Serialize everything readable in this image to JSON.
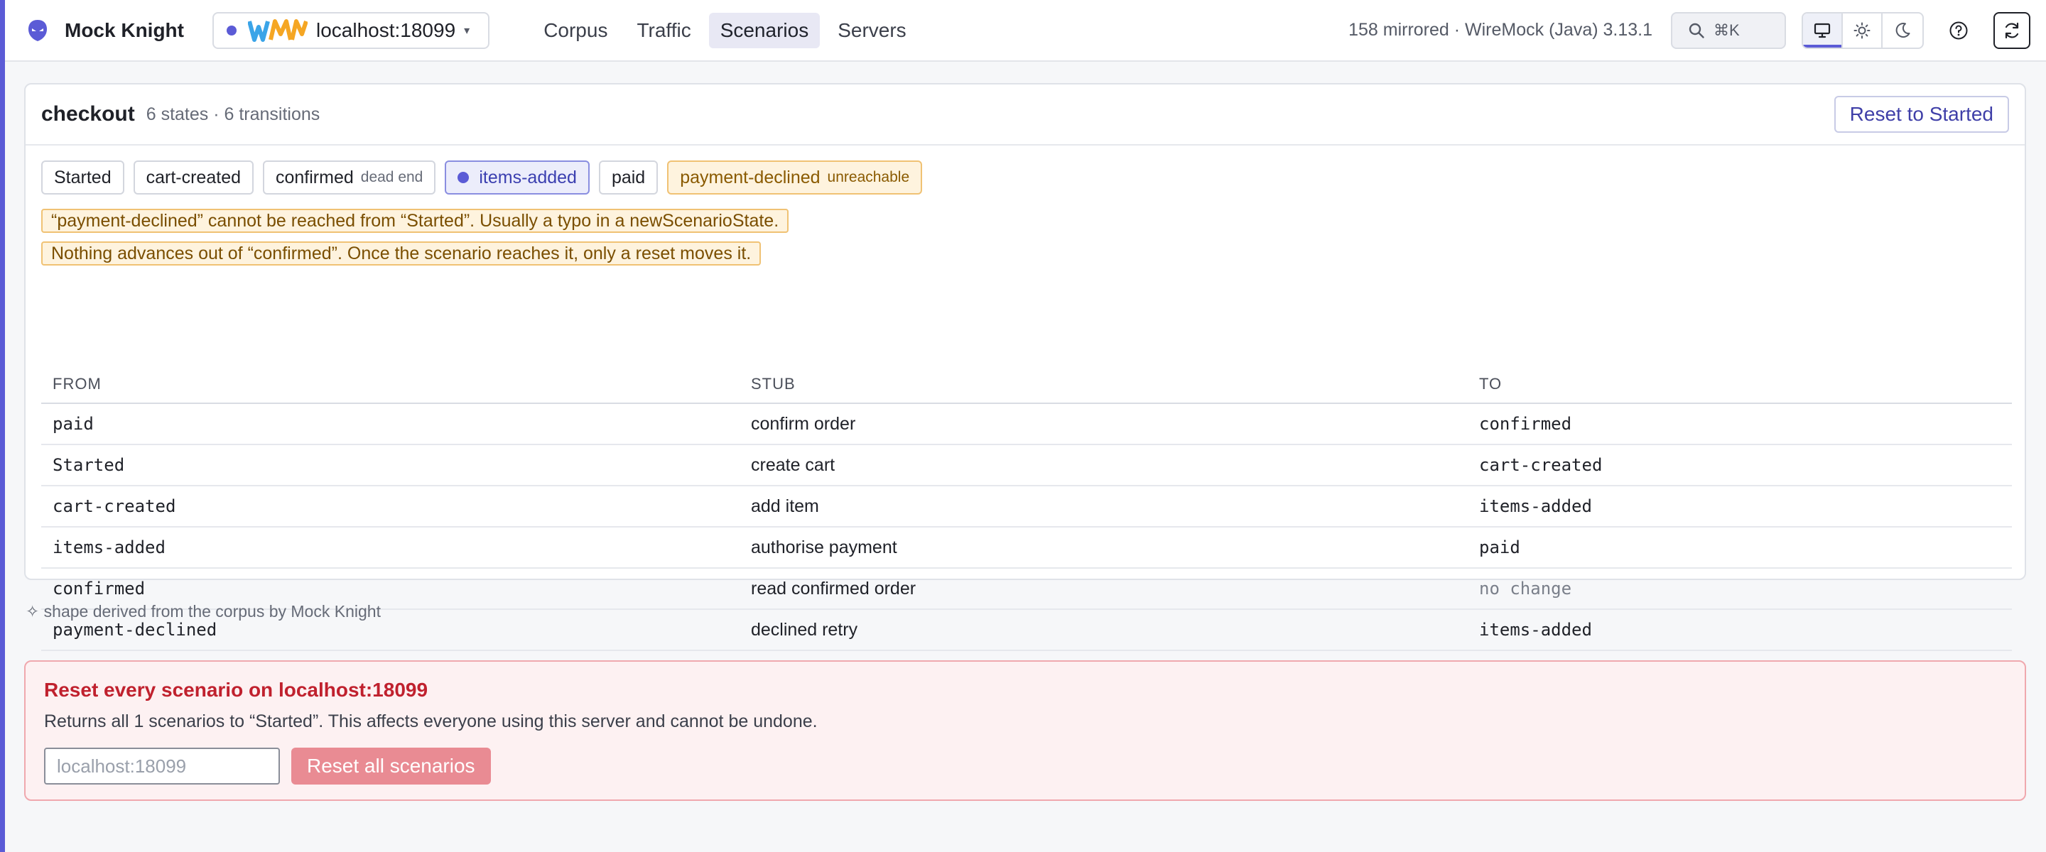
{
  "app": {
    "name": "Mock Knight",
    "brand_icon": "knight-helmet-icon",
    "accent_color": "#5b5bd6"
  },
  "server_picker": {
    "logo_text": "WM",
    "server": "localhost:18099",
    "status_color": "#5b5bd6"
  },
  "nav": {
    "items": [
      {
        "label": "Corpus",
        "active": false
      },
      {
        "label": "Traffic",
        "active": false
      },
      {
        "label": "Scenarios",
        "active": true
      },
      {
        "label": "Servers",
        "active": false
      }
    ]
  },
  "header": {
    "server_meta": "158 mirrored · WireMock (Java) 3.13.1",
    "search_shortcut": "⌘K",
    "theme_options": [
      "monitor-icon",
      "sun-icon",
      "moon-icon"
    ],
    "theme_selected": "monitor-icon"
  },
  "scenario": {
    "name": "checkout",
    "counts": "6 states · 6 transitions",
    "reset_label": "Reset to Started",
    "states": [
      {
        "label": "Started",
        "note": "",
        "kind": "normal"
      },
      {
        "label": "cart-created",
        "note": "",
        "kind": "normal"
      },
      {
        "label": "confirmed",
        "note": "dead end",
        "kind": "normal"
      },
      {
        "label": "items-added",
        "note": "",
        "kind": "current"
      },
      {
        "label": "paid",
        "note": "",
        "kind": "normal"
      },
      {
        "label": "payment-declined",
        "note": "unreachable",
        "kind": "warn"
      }
    ],
    "warnings": [
      "“payment-declined” cannot be reached from “Started”. Usually a typo in a newScenarioState.",
      "Nothing advances out of “confirmed”. Once the scenario reaches it, only a reset moves it."
    ],
    "table": {
      "headers": {
        "from": "FROM",
        "stub": "STUB",
        "to": "TO"
      },
      "rows": [
        {
          "from": "paid",
          "stub": "confirm order",
          "to": "confirmed"
        },
        {
          "from": "Started",
          "stub": "create cart",
          "to": "cart-created"
        },
        {
          "from": "cart-created",
          "stub": "add item",
          "to": "items-added"
        },
        {
          "from": "items-added",
          "stub": "authorise payment",
          "to": "paid"
        },
        {
          "from": "confirmed",
          "stub": "read confirmed order",
          "to": "no change"
        },
        {
          "from": "payment-declined",
          "stub": "declined retry",
          "to": "items-added"
        }
      ]
    }
  },
  "derived_note": "✧ shape derived from the corpus by Mock Knight",
  "danger": {
    "title": "Reset every scenario on localhost:18099",
    "description": "Returns all 1 scenarios to “Started”. This affects everyone using this server and cannot be undone.",
    "input_placeholder": "localhost:18099",
    "input_value": "",
    "button_label": "Reset all scenarios",
    "color": "#c0212e"
  }
}
